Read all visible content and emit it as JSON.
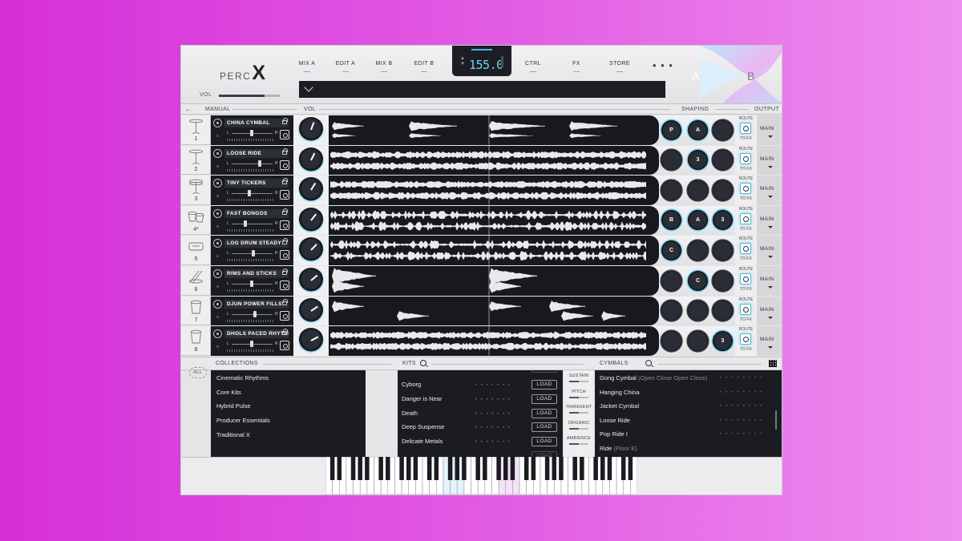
{
  "header": {
    "logo_perc": "PERC",
    "logo_x": "X",
    "vol_label": "VOL",
    "vol_level": 0.75,
    "nav_tabs": [
      {
        "label": "MIX A",
        "active": true
      },
      {
        "label": "EDIT A",
        "active": false
      },
      {
        "label": "MIX B",
        "active": false
      },
      {
        "label": "EDIT B",
        "active": false
      },
      {
        "label": "CTRL",
        "active": false
      },
      {
        "label": "FX",
        "active": false
      },
      {
        "label": "STORE",
        "active": false
      }
    ],
    "more_label": "• • •",
    "tempo": "155.0",
    "scene_a": "A",
    "scene_b": "B"
  },
  "section_bar": {
    "manual": "MANUAL",
    "vol": "VOL",
    "shaping": "SHAPING",
    "output": "OUTPUT"
  },
  "tracks": [
    {
      "num": "1",
      "name": "CHINA CYMBAL",
      "icon": "cymbal-stand-icon",
      "knobs": [
        "P",
        "A",
        ""
      ],
      "active": [
        true,
        true,
        false
      ],
      "wave": "sparse",
      "pan": 0.5
    },
    {
      "num": "2",
      "name": "LOOSE RIDE",
      "icon": "ride-cymbal-icon",
      "knobs": [
        "",
        "3",
        ""
      ],
      "active": [
        false,
        true,
        false
      ],
      "wave": "dense",
      "pan": 0.72
    },
    {
      "num": "3",
      "name": "TINY TICKERS",
      "icon": "hi-hat-icon",
      "knobs": [
        "",
        "",
        ""
      ],
      "active": [
        false,
        false,
        false
      ],
      "wave": "dense",
      "pan": 0.45
    },
    {
      "num": "4*",
      "name": "FAST BONGOS",
      "icon": "bongo-icon",
      "knobs": [
        "B",
        "A",
        "3"
      ],
      "active": [
        true,
        true,
        true
      ],
      "wave": "medium",
      "pan": 0.35
    },
    {
      "num": "5",
      "name": "LOG DRUM STEADY",
      "icon": "log-drum-icon",
      "knobs": [
        "C",
        "",
        ""
      ],
      "active": [
        true,
        false,
        false
      ],
      "wave": "medium",
      "pan": 0.55
    },
    {
      "num": "6",
      "name": "RIMS AND STICKS",
      "icon": "sticks-icon",
      "knobs": [
        "",
        "C",
        ""
      ],
      "active": [
        false,
        true,
        false
      ],
      "wave": "bursts",
      "pan": 0.5
    },
    {
      "num": "7",
      "name": "DJUN POWER FILLS",
      "icon": "djun-drum-icon",
      "knobs": [
        "",
        "",
        ""
      ],
      "active": [
        false,
        false,
        false
      ],
      "wave": "fills",
      "pan": 0.6
    },
    {
      "num": "8",
      "name": "DHOLS PACED RHYTHM",
      "icon": "dhol-drum-icon",
      "knobs": [
        "",
        "",
        "3"
      ],
      "active": [
        false,
        false,
        true
      ],
      "wave": "dense",
      "pan": 0.5
    }
  ],
  "track_labels": {
    "pan_l": "L",
    "pan_r": "R",
    "route": "ROUTE",
    "to_fx": "TO FX",
    "output": "MAIN"
  },
  "browser": {
    "collections_label": "COLLECTIONS",
    "kits_label": "KITS",
    "cymbals_label": "CYMBALS",
    "all_label": "ALL",
    "collections": [
      "Cinematic Rhythms",
      "Core Kits",
      "Hybrid Pulse",
      "Producer Essentials",
      "Traditional X"
    ],
    "kits": [
      "Cyborg",
      "Danger is Near",
      "Death",
      "Deep Suspense",
      "Delicate Metals"
    ],
    "load_label": "LOAD",
    "macros": [
      "SUSTAIN",
      "PITCH",
      "TRANSIENT",
      "ORGANIC",
      "AMBIENCE"
    ],
    "cymbals": [
      {
        "name": "Gong Cymbal",
        "sub": "(Open Close Open Close)"
      },
      {
        "name": "Hanging China",
        "sub": ""
      },
      {
        "name": "Jacket Cymbal",
        "sub": ""
      },
      {
        "name": "Loose Ride",
        "sub": ""
      },
      {
        "name": "Pop Ride I",
        "sub": ""
      },
      {
        "name": "Ride",
        "sub": "(Floor E)"
      }
    ],
    "dots": "• • • • • • • •",
    "kit_dots": "• • • • • • •"
  },
  "colors": {
    "accent": "#52b6d6",
    "panel_dark": "#1a1c22",
    "background_left": "#d62fd8",
    "background_right": "#ee8eef"
  }
}
